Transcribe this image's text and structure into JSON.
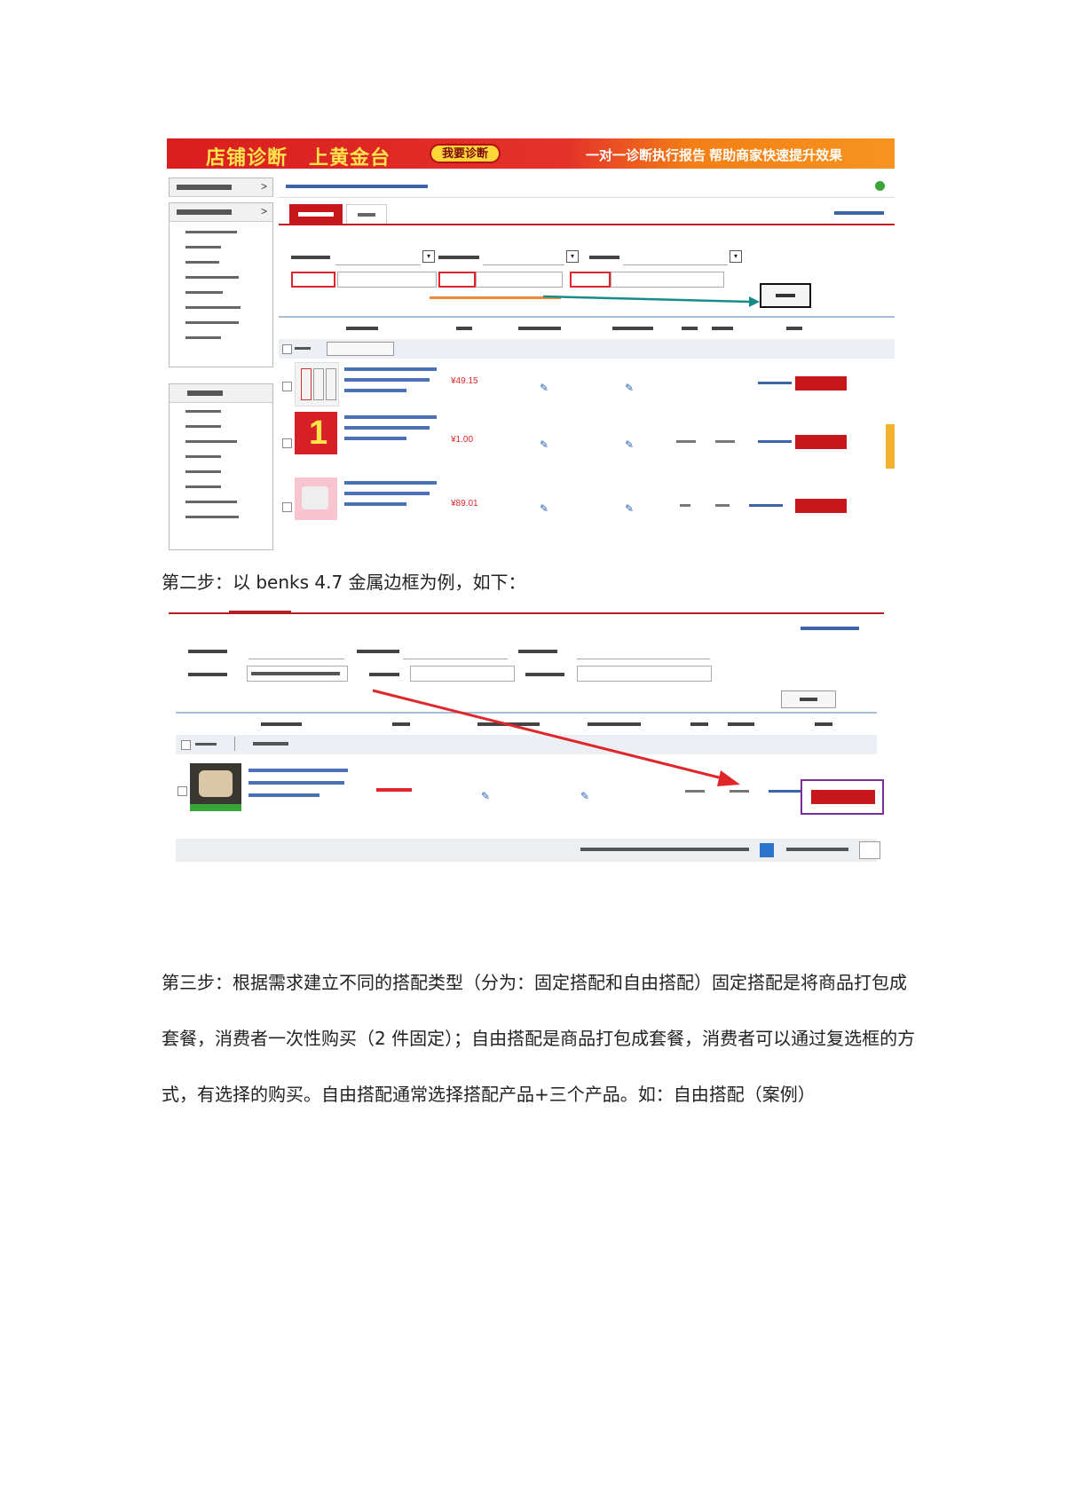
{
  "screenshot1": {
    "banner": {
      "title_left": "店铺诊断",
      "title_mid": "上黄金台",
      "button": "我要诊断",
      "slogan": "一对一诊断执行报告  帮助商家快速提升效果"
    },
    "accent_red": "#c8161d",
    "banner_orange": "#f79420",
    "rows": [
      {
        "price": "¥49.15"
      },
      {
        "price": "¥1.00"
      },
      {
        "price": "¥89.01"
      }
    ]
  },
  "caption2": "第二步：以 benks 4.7  金属边框为例，如下：",
  "screenshot2": {
    "accent_red": "#c8161d",
    "highlight_purple": "#7a2d9c"
  },
  "paragraph3": "第三步：根据需求建立不同的搭配类型（分为：固定搭配和自由搭配）固定搭配是将商品打包成套餐，消费者一次性购买（2 件固定）；自由搭配是商品打包成套餐，消费者可以通过复选框的方式，有选择的购买。自由搭配通常选择搭配产品+三个产品。如：自由搭配（案例）"
}
